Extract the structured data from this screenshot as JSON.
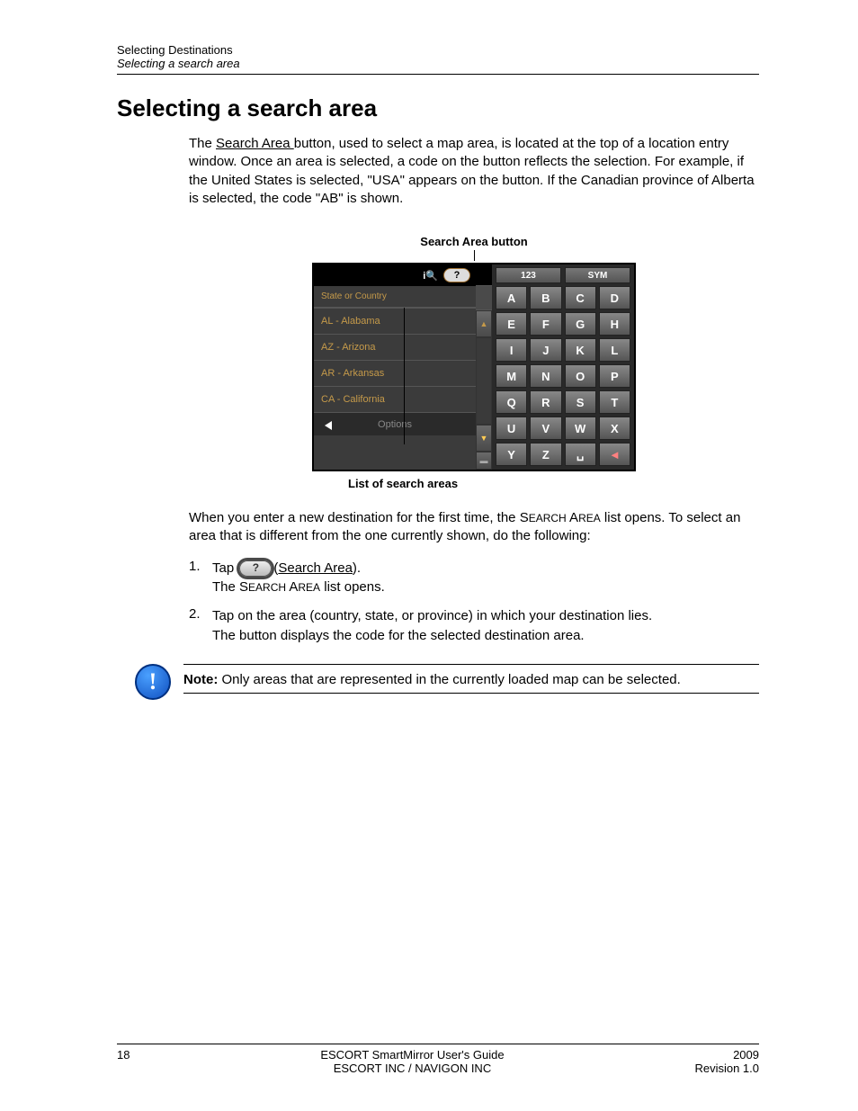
{
  "header": {
    "line1": "Selecting Destinations",
    "line2": "Selecting a search area"
  },
  "title": "Selecting a search area",
  "para1_pre": "The ",
  "para1_link": "Search Area ",
  "para1_post": "button, used to select a map area, is located at the top of a location entry window. Once an area is selected, a code on the button reflects the selection. For example, if the United States is selected, \"USA\" appears on the button. If the Canadian province of Alberta is selected, the code \"AB\" is shown.",
  "figure": {
    "callout_top": "Search Area button",
    "callout_bottom": "List of search areas",
    "search_btn_label": "?",
    "input_placeholder": "State or Country",
    "list": [
      "AL - Alabama",
      "AZ - Arizona",
      "AR - Arkansas",
      "CA - California"
    ],
    "options_label": "Options",
    "mode_123": "123",
    "mode_sym": "SYM",
    "keys": [
      "A",
      "B",
      "C",
      "D",
      "E",
      "F",
      "G",
      "H",
      "I",
      "J",
      "K",
      "L",
      "M",
      "N",
      "O",
      "P",
      "Q",
      "R",
      "S",
      "T",
      "U",
      "V",
      "W",
      "X",
      "Y",
      "Z",
      "␣",
      "⌫"
    ]
  },
  "para2": "When you enter a new destination for the first time, the SEARCH AREA list opens. To select an area that is different from the one currently shown, do the following:",
  "steps": {
    "s1_pre": "Tap ",
    "s1_link": "Search Area",
    "s1_post": ").",
    "s1_line2_pre": "The S",
    "s1_line2_sc": "EARCH ",
    "s1_line2_mid": "A",
    "s1_line2_sc2": "REA",
    "s1_line2_end": " list opens.",
    "s2a": "Tap on the area (country, state, or province) in which your destination lies.",
    "s2b": "The button displays the code for the selected destination area."
  },
  "note_label": "Note:",
  "note_text": " Only areas that are represented in the currently loaded map can be selected.",
  "footer": {
    "page": "18",
    "center1": "ESCORT SmartMirror User's Guide",
    "center2": "ESCORT INC / NAVIGON INC",
    "right1": "2009",
    "right2": "Revision 1.0"
  }
}
